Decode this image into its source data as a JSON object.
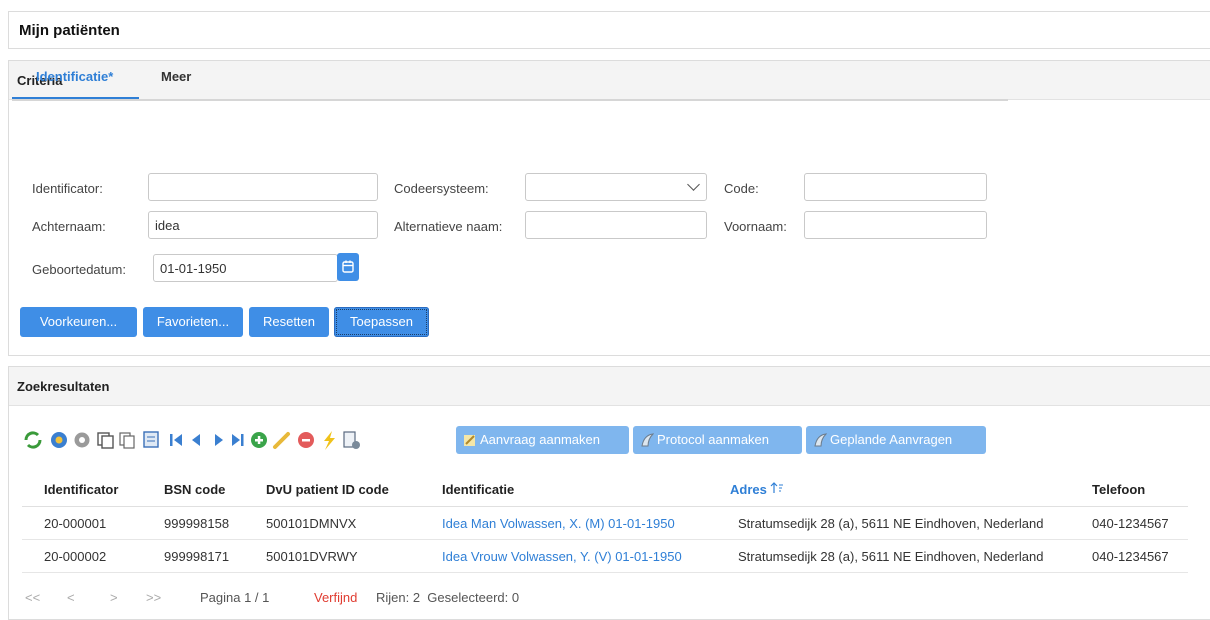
{
  "page": {
    "title": "Mijn patiënten"
  },
  "criteria": {
    "header": "Criteria",
    "tabs": [
      {
        "label": "Identificatie*",
        "active": true
      },
      {
        "label": "Meer",
        "active": false
      }
    ],
    "fields": {
      "identificator": {
        "label": "Identificator:",
        "value": ""
      },
      "codeersysteem": {
        "label": "Codeersysteem:",
        "value": ""
      },
      "code": {
        "label": "Code:",
        "value": ""
      },
      "achternaam": {
        "label": "Achternaam:",
        "value": "idea"
      },
      "alternatieve_naam": {
        "label": "Alternatieve naam:",
        "value": ""
      },
      "voornaam": {
        "label": "Voornaam:",
        "value": ""
      },
      "geboortedatum": {
        "label": "Geboortedatum:",
        "value": "01-01-1950"
      }
    },
    "buttons": {
      "voorkeuren": "Voorkeuren...",
      "favorieten": "Favorieten...",
      "resetten": "Resetten",
      "toepassen": "Toepassen"
    }
  },
  "results": {
    "header": "Zoekresultaten",
    "toolbar_buttons": {
      "aanvraag": "Aanvraag aanmaken",
      "protocol": "Protocol aanmaken",
      "geplande": "Geplande Aanvragen"
    },
    "columns": [
      "Identificator",
      "BSN code",
      "DvU patient ID code",
      "Identificatie",
      "Adres",
      "Telefoon"
    ],
    "rows": [
      [
        "20-000001",
        "999998158",
        "500101DMNVX",
        "Idea Man Volwassen, X. (M) 01-01-1950",
        "Stratumsedijk 28 (a), 5611 NE Eindhoven, Nederland",
        "040-1234567"
      ],
      [
        "20-000002",
        "999998171",
        "500101DVRWY",
        "Idea Vrouw Volwassen, Y. (V) 01-01-1950",
        "Stratumsedijk 28 (a), 5611 NE Eindhoven, Nederland",
        "040-1234567"
      ]
    ],
    "pager": {
      "first": "<<",
      "prev": "<",
      "next": ">",
      "last": ">>",
      "page_info": "Pagina 1 / 1",
      "refine": "Verfijnd",
      "summary": "Rijen: 2  Geselecteerd: 0"
    }
  },
  "colors": {
    "accent": "#3f8ee6",
    "link": "#2f7fd6",
    "refine": "#e03c31"
  }
}
